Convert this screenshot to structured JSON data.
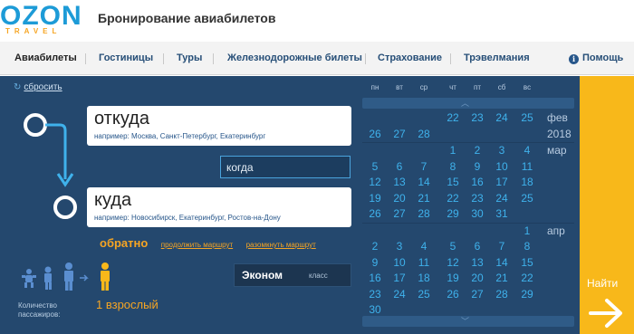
{
  "header": {
    "logo_main": "OZON",
    "logo_sub": "TRAVEL",
    "title": "Бронирование авиабилетов"
  },
  "nav": {
    "items": [
      {
        "label": "Авиабилеты",
        "active": true
      },
      {
        "label": "Гостиницы"
      },
      {
        "label": "Туры"
      },
      {
        "label": "Железнодорожные билеты"
      },
      {
        "label": "Страхование"
      },
      {
        "label": "Трэвелмания"
      }
    ],
    "help": "Помощь"
  },
  "search": {
    "reset": "сбросить",
    "from": {
      "title": "откуда",
      "hint_prefix": "например:",
      "hint_values": "Москва, Санкт-Петербург, Екатеринбург"
    },
    "to": {
      "title": "куда",
      "hint_prefix": "например:",
      "hint_values": "Новосибирск, Екатеринбург, Ростов-на-Дону"
    },
    "when": "когда",
    "back": "обратно",
    "continue_route": "продолжить маршрут",
    "split_route": "разомкнуть маршрут",
    "passengers_label": "Количество пассажиров:",
    "passengers_value": "1 взрослый",
    "class_value": "Эконом",
    "class_label": "класс",
    "find": "Найти"
  },
  "calendar": {
    "weekdays": [
      "пн",
      "вт",
      "ср",
      "чт",
      "пт",
      "сб",
      "вс"
    ],
    "year": "2018",
    "months": [
      {
        "name": "фев",
        "rows": [
          [
            "",
            "",
            "",
            "22",
            "23",
            "24",
            "25"
          ],
          [
            "26",
            "27",
            "28",
            "",
            "",
            "",
            ""
          ]
        ]
      },
      {
        "name": "мар",
        "rows": [
          [
            "",
            "",
            "",
            "1",
            "2",
            "3",
            "4"
          ],
          [
            "5",
            "6",
            "7",
            "8",
            "9",
            "10",
            "11"
          ],
          [
            "12",
            "13",
            "14",
            "15",
            "16",
            "17",
            "18"
          ],
          [
            "19",
            "20",
            "21",
            "22",
            "23",
            "24",
            "25"
          ],
          [
            "26",
            "27",
            "28",
            "29",
            "30",
            "31",
            ""
          ]
        ]
      },
      {
        "name": "апр",
        "rows": [
          [
            "",
            "",
            "",
            "",
            "",
            "",
            "1"
          ],
          [
            "2",
            "3",
            "4",
            "5",
            "6",
            "7",
            "8"
          ],
          [
            "9",
            "10",
            "11",
            "12",
            "13",
            "14",
            "15"
          ],
          [
            "16",
            "17",
            "18",
            "19",
            "20",
            "21",
            "22"
          ],
          [
            "23",
            "24",
            "25",
            "26",
            "27",
            "28",
            "29"
          ],
          [
            "30",
            "",
            "",
            "",
            "",
            "",
            ""
          ]
        ]
      }
    ]
  },
  "colors": {
    "panel": "#24486e",
    "accent": "#f6a523",
    "day": "#3fb2ec",
    "find": "#f8b81a"
  }
}
